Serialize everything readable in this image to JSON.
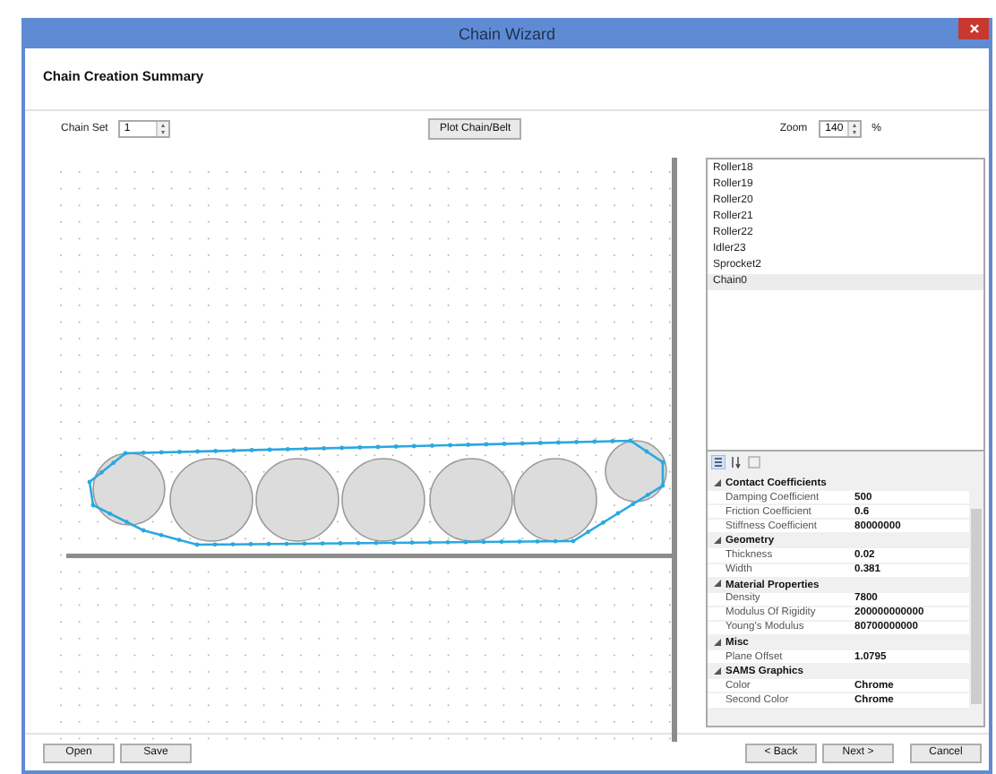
{
  "window": {
    "title": "Chain Wizard"
  },
  "header": {
    "title": "Chain Creation Summary"
  },
  "toolbar": {
    "chain_set_label": "Chain Set",
    "chain_set_value": "1",
    "plot_button": "Plot Chain/Belt",
    "zoom_label": "Zoom",
    "zoom_value": "140",
    "zoom_unit": "%"
  },
  "object_list": [
    {
      "label": "Roller18",
      "selected": false
    },
    {
      "label": "Roller19",
      "selected": false
    },
    {
      "label": "Roller20",
      "selected": false
    },
    {
      "label": "Roller21",
      "selected": false
    },
    {
      "label": "Roller22",
      "selected": false
    },
    {
      "label": "Idler23",
      "selected": false
    },
    {
      "label": "Sprocket2",
      "selected": false
    },
    {
      "label": "Chain0",
      "selected": true
    }
  ],
  "property_grid": {
    "categories": [
      {
        "name": "Contact Coefficients",
        "expanded": true,
        "properties": [
          {
            "name": "Damping Coefficient",
            "value": "500"
          },
          {
            "name": "Friction Coefficient",
            "value": "0.6"
          },
          {
            "name": "Stiffness Coefficient",
            "value": "80000000"
          }
        ]
      },
      {
        "name": "Geometry",
        "expanded": true,
        "properties": [
          {
            "name": "Thickness",
            "value": "0.02"
          },
          {
            "name": "Width",
            "value": "0.381"
          }
        ]
      },
      {
        "name": "Material Properties",
        "expanded": true,
        "properties": [
          {
            "name": "Density",
            "value": "7800"
          },
          {
            "name": "Modulus Of Rigidity",
            "value": "200000000000"
          },
          {
            "name": "Young's Modulus",
            "value": "80700000000"
          }
        ]
      },
      {
        "name": "Misc",
        "expanded": true,
        "properties": [
          {
            "name": "Plane Offset",
            "value": "1.0795"
          }
        ]
      },
      {
        "name": "SAMS Graphics",
        "expanded": true,
        "properties": [
          {
            "name": "Color",
            "value": "Chrome"
          },
          {
            "name": "Second Color",
            "value": "Chrome"
          }
        ]
      }
    ]
  },
  "footer": {
    "left_buttons": [
      "Open",
      "Save"
    ],
    "right_buttons": [
      "< Back",
      "Next >",
      "Cancel"
    ]
  }
}
